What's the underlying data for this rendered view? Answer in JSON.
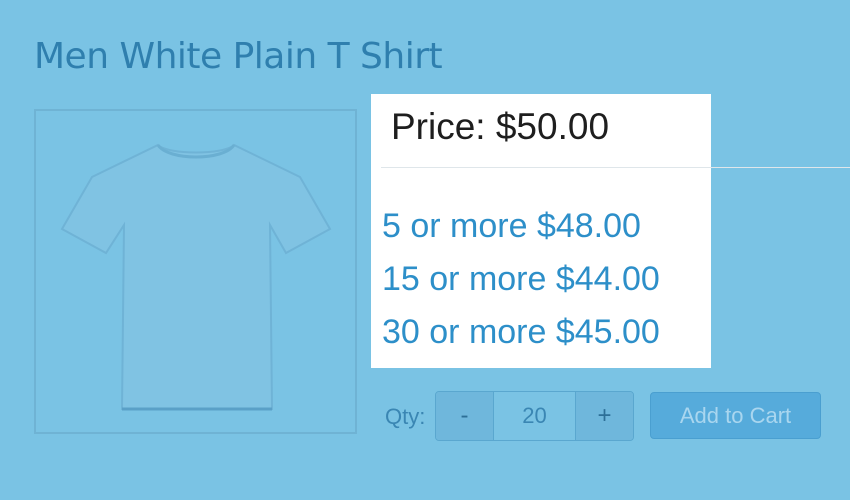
{
  "product": {
    "title": "Men White Plain T Shirt"
  },
  "pricing": {
    "price_line": "Price: $50.00",
    "tiers": [
      {
        "label": "5 or more $48.00"
      },
      {
        "label": "15 or more $44.00"
      },
      {
        "label": "30 or more $45.00"
      }
    ]
  },
  "quantity": {
    "label": "Qty:",
    "decrement_label": "-",
    "value": "20",
    "increment_label": "+"
  },
  "cart": {
    "add_label": "Add to Cart"
  },
  "colors": {
    "overlay": "#7ac3e4",
    "accent": "#2d8fc9",
    "button": "#56abdb"
  }
}
